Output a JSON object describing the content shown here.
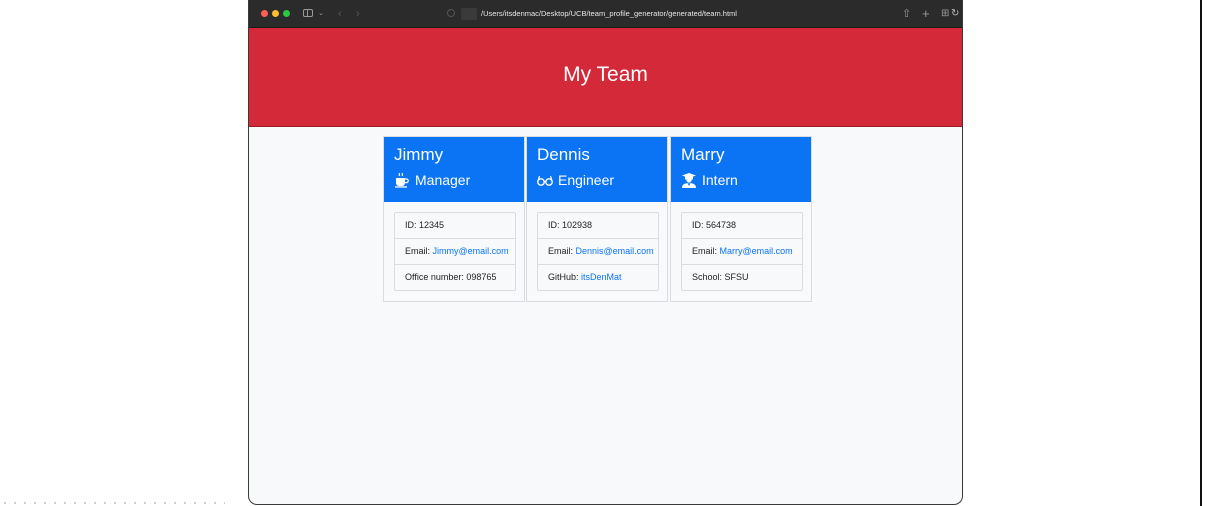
{
  "browser": {
    "url": "/Users/itsdenmac/Desktop/UCB/team_profile_generator/generated/team.html"
  },
  "page": {
    "title": "My Team"
  },
  "team": [
    {
      "name": "Jimmy",
      "role": "Manager",
      "icon": "coffee-icon",
      "id_label": "ID: ",
      "id": "12345",
      "email_label": "Email: ",
      "email": "Jimmy@email.com",
      "extra_label": "Office number: ",
      "extra": "098765"
    },
    {
      "name": "Dennis",
      "role": "Engineer",
      "icon": "glasses-icon",
      "id_label": "ID: ",
      "id": "102938",
      "email_label": "Email: ",
      "email": "Dennis@email.com",
      "extra_label": "GitHub: ",
      "extra": "itsDenMat"
    },
    {
      "name": "Marry",
      "role": "Intern",
      "icon": "graduate-icon",
      "id_label": "ID: ",
      "id": "564738",
      "email_label": "Email: ",
      "email": "Marry@email.com",
      "extra_label": "School: ",
      "extra": "SFSU"
    }
  ],
  "colors": {
    "header_red": "#d32939",
    "card_header_blue": "#0a74f5",
    "link_blue": "#0a74f5",
    "page_bg": "#f8f9fa"
  }
}
